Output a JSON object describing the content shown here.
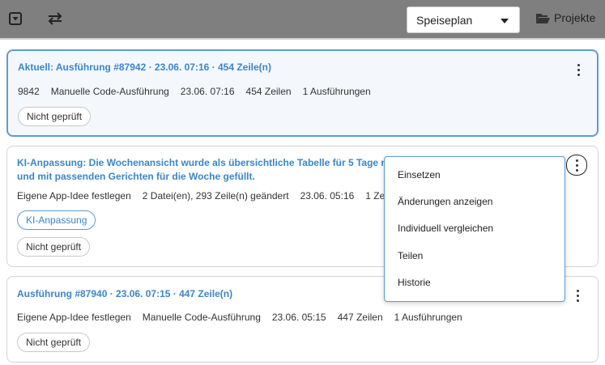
{
  "toolbar": {
    "left_icons": [
      "dropdown-box-icon",
      "swap-arrows-icon"
    ],
    "select": {
      "value": "Speiseplan"
    },
    "projects_label": "Projekte"
  },
  "cards": [
    {
      "title": "Aktuell: Ausführung #87942 · 23.06. 07:16 · 454 Zeile(n)",
      "meta": [
        "9842",
        "Manuelle Code-Ausführung",
        "23.06. 07:16",
        "454 Zeilen",
        "1 Ausführungen"
      ],
      "status": "Nicht geprüft"
    },
    {
      "title": "KI-Anpassung: Die Wochenansicht wurde als übersichtliche Tabelle für 5 Tage mit je 3",
      "title_line2": "und mit passenden Gerichten für die Woche gefüllt.",
      "meta": [
        "Eigene App-Idee festlegen",
        "2 Datei(en), 293 Zeile(n) geändert",
        "23.06. 05:16",
        "1 Zeil"
      ],
      "tag": "KI-Anpassung",
      "status": "Nicht geprüft"
    },
    {
      "title": "Ausführung #87940 · 23.06. 07:15 · 447 Zeile(n)",
      "meta": [
        "Eigene App-Idee festlegen",
        "Manuelle Code-Ausführung",
        "23.06. 05:15",
        "447 Zeilen",
        "1 Ausführungen"
      ],
      "status": "Nicht geprüft"
    }
  ],
  "context_menu": {
    "items": [
      "Einsetzen",
      "Änderungen anzeigen",
      "Individuell vergleichen",
      "Teilen",
      "Historie"
    ]
  },
  "colors": {
    "accent": "#3a86c8",
    "toolbar": "#7f7f7f",
    "active_card_border": "#5b9bd5"
  }
}
